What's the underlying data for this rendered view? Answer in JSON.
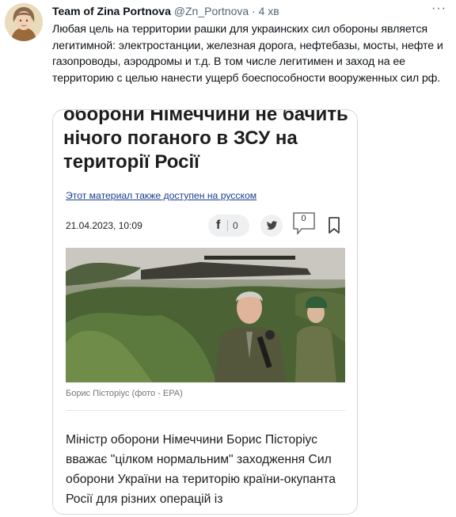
{
  "tweet": {
    "author_name": "Team of Zina Portnova",
    "handle": "@Zn_Portnova",
    "separator": "·",
    "time": "4 хв",
    "more_label": "···",
    "text": "Любая цель на территории рашки для украинских сил обороны является легитимной: электростанции, железная дорога, нефтебазы, мосты, нефте и газопроводы, аэродромы и т.д. В том числе легитимен и заход на ее территорию с целью нанести ущерб боеспособности вооруженных сил рф."
  },
  "article": {
    "title": "оборони Німеччини не бачить нічого поганого в ЗСУ на території Росії",
    "ru_link": "Этот материал также доступен на русском",
    "date": "21.04.2023, 10:09",
    "fb_icon": "f",
    "fb_count": "0",
    "comment_count": "0",
    "photo_caption": "Борис Пісторіус (фото - EPA)",
    "body": "Міністр оборони Німеччини Борис Пісторіус вважає \"цілком нормальним\" заходження Сил оборони України на територію країни-окупанта Росії для різних операцій із"
  },
  "icons": {
    "avatar": "avatar-portrait",
    "facebook": "facebook-icon",
    "twitter": "twitter-bird-icon",
    "comment": "comment-bubble-icon",
    "bookmark": "bookmark-icon"
  },
  "colors": {
    "link": "#1a3d8f",
    "secondary_text": "#536471",
    "card_border": "#cfd9de"
  }
}
